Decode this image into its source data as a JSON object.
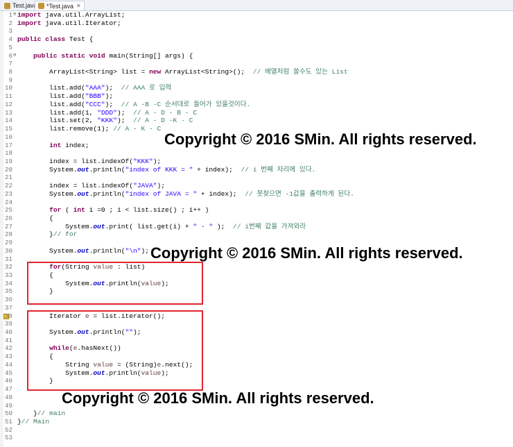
{
  "tabs": [
    {
      "label": "Test.java",
      "active": false
    },
    {
      "label": "*Test.java",
      "active": true
    }
  ],
  "watermark": "Copyright © 2016 SMin. All rights reserved.",
  "lines": [
    {
      "n": "1",
      "fold": "⊖",
      "segs": [
        [
          "kw",
          "import"
        ],
        [
          "",
          "java.util.ArrayList;"
        ]
      ]
    },
    {
      "n": "2",
      "segs": [
        [
          "kw",
          "import"
        ],
        [
          "",
          "java.util.Iterator;"
        ]
      ]
    },
    {
      "n": "3",
      "segs": []
    },
    {
      "n": "4",
      "segs": [
        [
          "kw",
          "public class"
        ],
        [
          "",
          "Test {"
        ]
      ]
    },
    {
      "n": "5",
      "segs": []
    },
    {
      "n": "6",
      "fold": "⊖",
      "segs": [
        [
          "",
          "    "
        ],
        [
          "kw",
          "public static void"
        ],
        [
          "",
          " main(String[] args) {"
        ]
      ]
    },
    {
      "n": "7",
      "segs": []
    },
    {
      "n": "8",
      "segs": [
        [
          "",
          "        ArrayList<String> list = "
        ],
        [
          "kw",
          "new"
        ],
        [
          "",
          " ArrayList<String>();  "
        ],
        [
          "cm",
          "// 배열처럼 쓸수도 있는 List"
        ]
      ]
    },
    {
      "n": "9",
      "segs": []
    },
    {
      "n": "10",
      "segs": [
        [
          "",
          "        list.add("
        ],
        [
          "str",
          "\"AAA\""
        ],
        [
          "",
          ");  "
        ],
        [
          "cm",
          "// AAA 로 입력"
        ]
      ]
    },
    {
      "n": "11",
      "segs": [
        [
          "",
          "        list.add("
        ],
        [
          "str",
          "\"BBB\""
        ],
        [
          "",
          ");"
        ]
      ]
    },
    {
      "n": "12",
      "segs": [
        [
          "",
          "        list.add("
        ],
        [
          "str",
          "\"CCC\""
        ],
        [
          "",
          ");  "
        ],
        [
          "cm",
          "// A -B -C 순서대로 들어가 있을것이다."
        ]
      ]
    },
    {
      "n": "13",
      "segs": [
        [
          "",
          "        list.add(1, "
        ],
        [
          "str",
          "\"DDD\""
        ],
        [
          "",
          ");  "
        ],
        [
          "cm",
          "// A - D - B - C"
        ]
      ]
    },
    {
      "n": "14",
      "segs": [
        [
          "",
          "        list.set(2, "
        ],
        [
          "str",
          "\"KKK\""
        ],
        [
          "",
          ");  "
        ],
        [
          "cm",
          "// A - D -K - C"
        ]
      ]
    },
    {
      "n": "15",
      "segs": [
        [
          "",
          "        list.remove(1); "
        ],
        [
          "cm",
          "// A - K - C"
        ]
      ]
    },
    {
      "n": "16",
      "segs": []
    },
    {
      "n": "17",
      "segs": [
        [
          "",
          "        "
        ],
        [
          "kw",
          "int"
        ],
        [
          "",
          " index;"
        ]
      ]
    },
    {
      "n": "18",
      "segs": []
    },
    {
      "n": "19",
      "segs": [
        [
          "",
          "        index = list.indexOf("
        ],
        [
          "str",
          "\"KKK\""
        ],
        [
          "",
          ");"
        ]
      ]
    },
    {
      "n": "20",
      "segs": [
        [
          "",
          "        System."
        ],
        [
          "st",
          "out"
        ],
        [
          "",
          ".println("
        ],
        [
          "str",
          "\"index of KKK = \""
        ],
        [
          "",
          " + index);  "
        ],
        [
          "cm",
          "// i 번째 자리에 있다."
        ]
      ]
    },
    {
      "n": "21",
      "segs": []
    },
    {
      "n": "22",
      "segs": [
        [
          "",
          "        index = list.indexOf("
        ],
        [
          "str",
          "\"JAVA\""
        ],
        [
          "",
          ");"
        ]
      ]
    },
    {
      "n": "23",
      "segs": [
        [
          "",
          "        System."
        ],
        [
          "st",
          "out"
        ],
        [
          "",
          ".println("
        ],
        [
          "str",
          "\"index of JAVA = \""
        ],
        [
          "",
          " + index);  "
        ],
        [
          "cm",
          "// 못찾으면 -1값을 출력하게 된다."
        ]
      ]
    },
    {
      "n": "24",
      "segs": []
    },
    {
      "n": "25",
      "segs": [
        [
          "",
          "        "
        ],
        [
          "kw",
          "for"
        ],
        [
          "",
          " ( "
        ],
        [
          "kw",
          "int"
        ],
        [
          "",
          " i =0 ; i < list.size() ; i++ )"
        ]
      ]
    },
    {
      "n": "26",
      "segs": [
        [
          "",
          "        {"
        ]
      ]
    },
    {
      "n": "27",
      "segs": [
        [
          "",
          "            System."
        ],
        [
          "st",
          "out"
        ],
        [
          "",
          ".print( list.get(i) + "
        ],
        [
          "str",
          "\" - \""
        ],
        [
          "",
          " );  "
        ],
        [
          "cm",
          "// i번째 값을 가져와라"
        ]
      ]
    },
    {
      "n": "28",
      "segs": [
        [
          "",
          "        }"
        ],
        [
          "cm",
          "// for"
        ]
      ]
    },
    {
      "n": "29",
      "segs": []
    },
    {
      "n": "30",
      "segs": [
        [
          "",
          "        System."
        ],
        [
          "st",
          "out"
        ],
        [
          "",
          ".println("
        ],
        [
          "str",
          "\"\\n\""
        ],
        [
          "",
          ");"
        ]
      ]
    },
    {
      "n": "31",
      "segs": []
    },
    {
      "n": "32",
      "segs": [
        [
          "",
          "        "
        ],
        [
          "kw",
          "for"
        ],
        [
          "",
          "(String "
        ],
        [
          "var",
          "value"
        ],
        [
          "",
          " : list)"
        ]
      ]
    },
    {
      "n": "33",
      "segs": [
        [
          "",
          "        {"
        ]
      ]
    },
    {
      "n": "34",
      "segs": [
        [
          "",
          "            System."
        ],
        [
          "st",
          "out"
        ],
        [
          "",
          ".println("
        ],
        [
          "var",
          "value"
        ],
        [
          "",
          ");"
        ]
      ]
    },
    {
      "n": "35",
      "segs": [
        [
          "",
          "        }"
        ]
      ]
    },
    {
      "n": "36",
      "segs": []
    },
    {
      "n": "37",
      "segs": []
    },
    {
      "n": "38",
      "mark": true,
      "segs": [
        [
          "",
          "        Iterator "
        ],
        [
          "var",
          "e"
        ],
        [
          "",
          " = list.iterator();"
        ]
      ]
    },
    {
      "n": "39",
      "segs": []
    },
    {
      "n": "40",
      "segs": [
        [
          "",
          "        System."
        ],
        [
          "st",
          "out"
        ],
        [
          "",
          ".println("
        ],
        [
          "str",
          "\"\""
        ],
        [
          "",
          ");"
        ]
      ]
    },
    {
      "n": "41",
      "segs": []
    },
    {
      "n": "42",
      "segs": [
        [
          "",
          "        "
        ],
        [
          "kw",
          "while"
        ],
        [
          "",
          "("
        ],
        [
          "var",
          "e"
        ],
        [
          "",
          ".hasNext())"
        ]
      ]
    },
    {
      "n": "43",
      "segs": [
        [
          "",
          "        {"
        ]
      ]
    },
    {
      "n": "44",
      "segs": [
        [
          "",
          "            String "
        ],
        [
          "var",
          "value"
        ],
        [
          "",
          " = (String)"
        ],
        [
          "var",
          "e"
        ],
        [
          "",
          ".next();"
        ]
      ]
    },
    {
      "n": "45",
      "segs": [
        [
          "",
          "            System."
        ],
        [
          "st",
          "out"
        ],
        [
          "",
          ".println("
        ],
        [
          "var",
          "value"
        ],
        [
          "",
          ");"
        ]
      ]
    },
    {
      "n": "46",
      "segs": [
        [
          "",
          "        }"
        ]
      ]
    },
    {
      "n": "47",
      "segs": []
    },
    {
      "n": "48",
      "segs": []
    },
    {
      "n": "49",
      "segs": []
    },
    {
      "n": "50",
      "segs": [
        [
          "",
          "    }"
        ],
        [
          "cm",
          "// main"
        ]
      ]
    },
    {
      "n": "51",
      "segs": [
        [
          "",
          "}"
        ],
        [
          "cm",
          "// Main"
        ]
      ]
    },
    {
      "n": "52",
      "segs": []
    },
    {
      "n": "53",
      "segs": []
    }
  ]
}
